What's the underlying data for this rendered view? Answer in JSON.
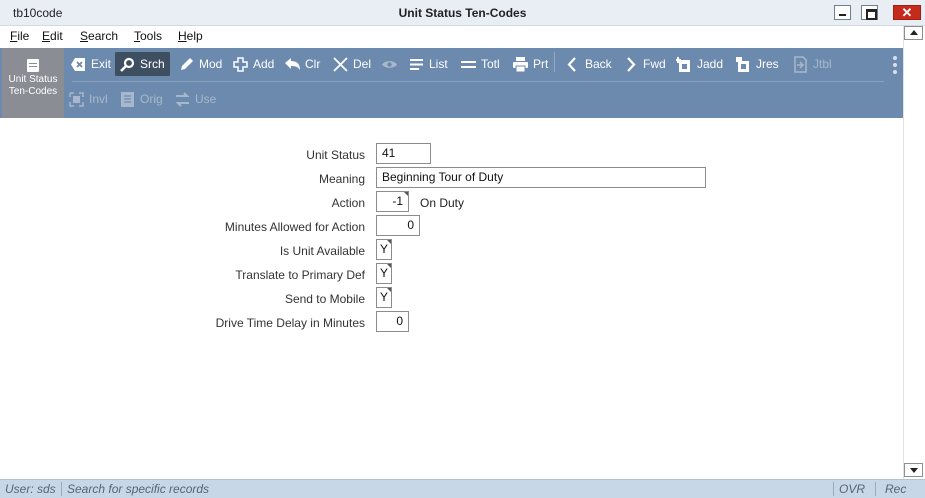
{
  "window": {
    "app_name": "tb10code",
    "title": "Unit Status Ten-Codes",
    "close_glyph": "✕"
  },
  "menu": [
    "File",
    "Edit",
    "Search",
    "Tools",
    "Help"
  ],
  "form_id": {
    "icon": "form-icon",
    "line1": "Unit Status",
    "line2": "Ten-Codes"
  },
  "toolbar": {
    "row1": [
      {
        "label": "Exit",
        "icon": "exit-icon",
        "active": false,
        "disabled": false
      },
      {
        "label": "Srch",
        "icon": "search-icon",
        "active": true,
        "disabled": false
      },
      {
        "label": "Mod",
        "icon": "pencil-icon",
        "active": false,
        "disabled": false
      },
      {
        "label": "Add",
        "icon": "plus-icon",
        "active": false,
        "disabled": false
      },
      {
        "label": "Clr",
        "icon": "undo-icon",
        "active": false,
        "disabled": false
      },
      {
        "label": "Del",
        "icon": "x-icon",
        "active": false,
        "disabled": false
      },
      {
        "label": "List",
        "icon": "list-icon",
        "active": false,
        "disabled": false
      },
      {
        "label": "Totl",
        "icon": "total-icon",
        "active": false,
        "disabled": false
      },
      {
        "label": "Prt",
        "icon": "printer-icon",
        "active": false,
        "disabled": false
      },
      {
        "label": "Back",
        "icon": "chevron-left-icon",
        "active": false,
        "disabled": false
      },
      {
        "label": "Fwd",
        "icon": "chevron-right-icon",
        "active": false,
        "disabled": false
      },
      {
        "label": "Jadd",
        "icon": "jadd-icon",
        "active": false,
        "disabled": false
      },
      {
        "label": "Jres",
        "icon": "jres-icon",
        "active": false,
        "disabled": false
      },
      {
        "label": "Jtbl",
        "icon": "jtbl-icon",
        "active": false,
        "disabled": true
      }
    ],
    "row2": [
      {
        "label": "Invl",
        "icon": "invl-icon",
        "disabled": true
      },
      {
        "label": "Orig",
        "icon": "orig-icon",
        "disabled": true
      },
      {
        "label": "Use",
        "icon": "swap-icon",
        "disabled": true
      }
    ],
    "eye_icon": "eye-icon",
    "more_icon": "more-vertical-icon"
  },
  "fields": [
    {
      "label": "Unit Status",
      "value": "41"
    },
    {
      "label": "Meaning",
      "value": "Beginning Tour of Duty"
    },
    {
      "label": "Action",
      "value": "-1",
      "desc": "On Duty"
    },
    {
      "label": "Minutes Allowed for Action",
      "value": "0"
    },
    {
      "label": "Is Unit Available",
      "value": "Y"
    },
    {
      "label": "Translate to Primary Def",
      "value": "Y"
    },
    {
      "label": "Send to Mobile",
      "value": "Y"
    },
    {
      "label": "Drive Time Delay in Minutes",
      "value": "0"
    }
  ],
  "status": {
    "user": "User: sds",
    "message": "Search for specific records",
    "mode": "OVR",
    "record": "Rec"
  },
  "colors": {
    "toolbar_bg": "#6c8aae",
    "active_button": "#3f4f62",
    "status_bg": "#c7d7e8"
  }
}
